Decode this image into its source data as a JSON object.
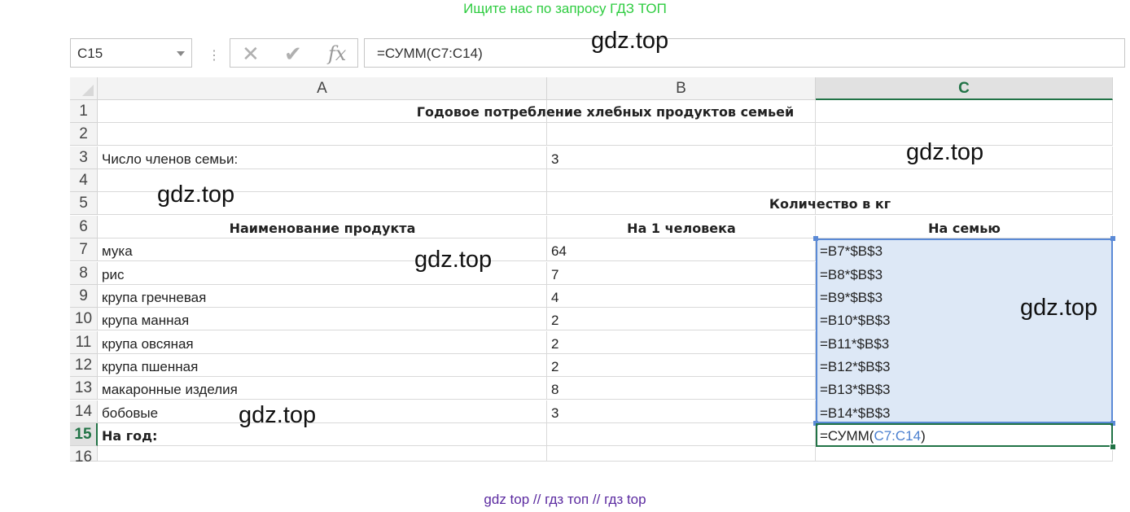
{
  "banner_top": "Ищите нас по запросу ГДЗ ТОП",
  "banner_bottom": "gdz top  //  гдз топ  //  гдз top",
  "watermark_text": "gdz.top",
  "namebox": {
    "value": "C15"
  },
  "formula_bar": {
    "cancel_icon": "✕",
    "enter_icon": "✔",
    "fx_icon": "fx",
    "value": "=СУММ(C7:C14)"
  },
  "columns": [
    "A",
    "B",
    "C"
  ],
  "rows": [
    "1",
    "2",
    "3",
    "4",
    "5",
    "6",
    "7",
    "8",
    "9",
    "10",
    "11",
    "12",
    "13",
    "14",
    "15",
    "16"
  ],
  "sheet": {
    "title": "Годовое потребление хлебных продуктов семьей",
    "family_label": "Число членов семьи:",
    "family_value": "3",
    "qty_header": "Количество в кг",
    "name_header": "Наименование продукта",
    "per_person_header": "На 1 человека",
    "per_family_header": "На семью",
    "items": [
      {
        "name": "мука",
        "per_person": "64",
        "formula": "=B7*$B$3"
      },
      {
        "name": "рис",
        "per_person": "7",
        "formula": "=B8*$B$3"
      },
      {
        "name": "крупа гречневая",
        "per_person": "4",
        "formula": "=B9*$B$3"
      },
      {
        "name": "крупа манная",
        "per_person": "2",
        "formula": "=B10*$B$3"
      },
      {
        "name": "крупа овсяная",
        "per_person": "2",
        "formula": "=B11*$B$3"
      },
      {
        "name": "крупа пшенная",
        "per_person": "2",
        "formula": "=B12*$B$3"
      },
      {
        "name": "макаронные изделия",
        "per_person": "8",
        "formula": "=B13*$B$3"
      },
      {
        "name": "бобовые",
        "per_person": "3",
        "formula": "=B14*$B$3"
      }
    ],
    "total_label": "На год:",
    "total_formula_prefix": "=СУММ(",
    "total_formula_ref": "C7:C14",
    "total_formula_suffix": ")"
  },
  "colors": {
    "accent_green": "#217346",
    "selection_blue": "#5b8ad6",
    "banner_green": "#2ecc40",
    "banner_purple": "#5b2aa0"
  }
}
